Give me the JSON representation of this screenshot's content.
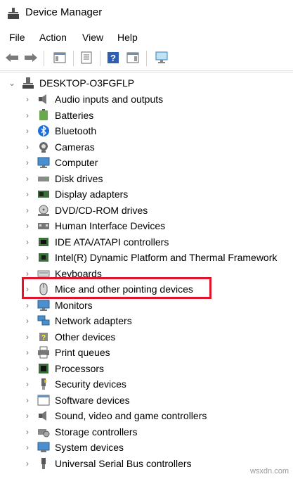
{
  "window": {
    "title": "Device Manager"
  },
  "menu": [
    "File",
    "Action",
    "View",
    "Help"
  ],
  "tree": {
    "root": "DESKTOP-O3FGFLP",
    "items": [
      {
        "label": "Audio inputs and outputs",
        "icon": "speaker-icon"
      },
      {
        "label": "Batteries",
        "icon": "battery-icon"
      },
      {
        "label": "Bluetooth",
        "icon": "bluetooth-icon"
      },
      {
        "label": "Cameras",
        "icon": "camera-icon"
      },
      {
        "label": "Computer",
        "icon": "monitor-icon"
      },
      {
        "label": "Disk drives",
        "icon": "disk-drive-icon"
      },
      {
        "label": "Display adapters",
        "icon": "display-adapter-icon"
      },
      {
        "label": "DVD/CD-ROM drives",
        "icon": "optical-drive-icon"
      },
      {
        "label": "Human Interface Devices",
        "icon": "hid-icon"
      },
      {
        "label": "IDE ATA/ATAPI controllers",
        "icon": "ide-controller-icon"
      },
      {
        "label": "Intel(R) Dynamic Platform and Thermal Framework",
        "icon": "chip-icon"
      },
      {
        "label": "Keyboards",
        "icon": "keyboard-icon"
      },
      {
        "label": "Mice and other pointing devices",
        "icon": "mouse-icon"
      },
      {
        "label": "Monitors",
        "icon": "monitor-icon"
      },
      {
        "label": "Network adapters",
        "icon": "network-icon"
      },
      {
        "label": "Other devices",
        "icon": "unknown-device-icon"
      },
      {
        "label": "Print queues",
        "icon": "printer-icon"
      },
      {
        "label": "Processors",
        "icon": "processor-icon"
      },
      {
        "label": "Security devices",
        "icon": "security-device-icon"
      },
      {
        "label": "Software devices",
        "icon": "software-device-icon"
      },
      {
        "label": "Sound, video and game controllers",
        "icon": "speaker-icon"
      },
      {
        "label": "Storage controllers",
        "icon": "storage-controller-icon"
      },
      {
        "label": "System devices",
        "icon": "system-device-icon"
      },
      {
        "label": "Universal Serial Bus controllers",
        "icon": "usb-icon"
      }
    ]
  },
  "colors": {
    "highlight_border": "#e0142a",
    "selection_bg": "#cce8ff"
  },
  "watermark": "wsxdn.com"
}
